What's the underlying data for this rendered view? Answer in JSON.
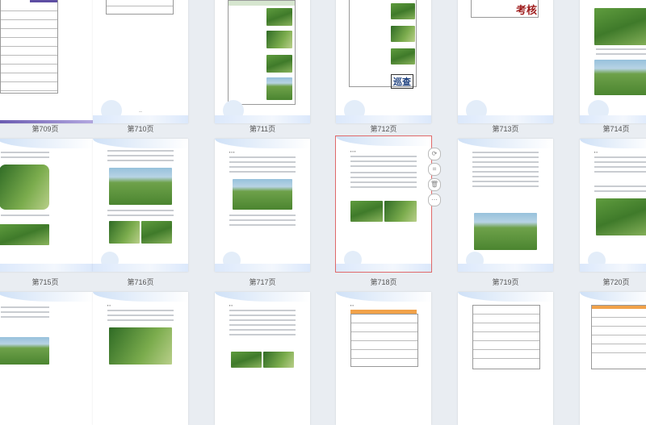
{
  "pages": [
    {
      "label": "第709页"
    },
    {
      "label": "第710页"
    },
    {
      "label": "第711页"
    },
    {
      "label": "第712页"
    },
    {
      "label": "第713页"
    },
    {
      "label": "第714页"
    },
    {
      "label": "第715页"
    },
    {
      "label": "第716页"
    },
    {
      "label": "第717页"
    },
    {
      "label": "第718页"
    },
    {
      "label": "第719页"
    },
    {
      "label": "第720页"
    }
  ],
  "stamps": {
    "kaohe": "考核",
    "xuncha": "巡查"
  },
  "selected_page": "第718页",
  "colors": {
    "selection_border": "#e06a6a",
    "background": "#e9edf2"
  },
  "side_tools": [
    "rotate-icon",
    "crop-icon",
    "delete-icon",
    "more-icon"
  ]
}
